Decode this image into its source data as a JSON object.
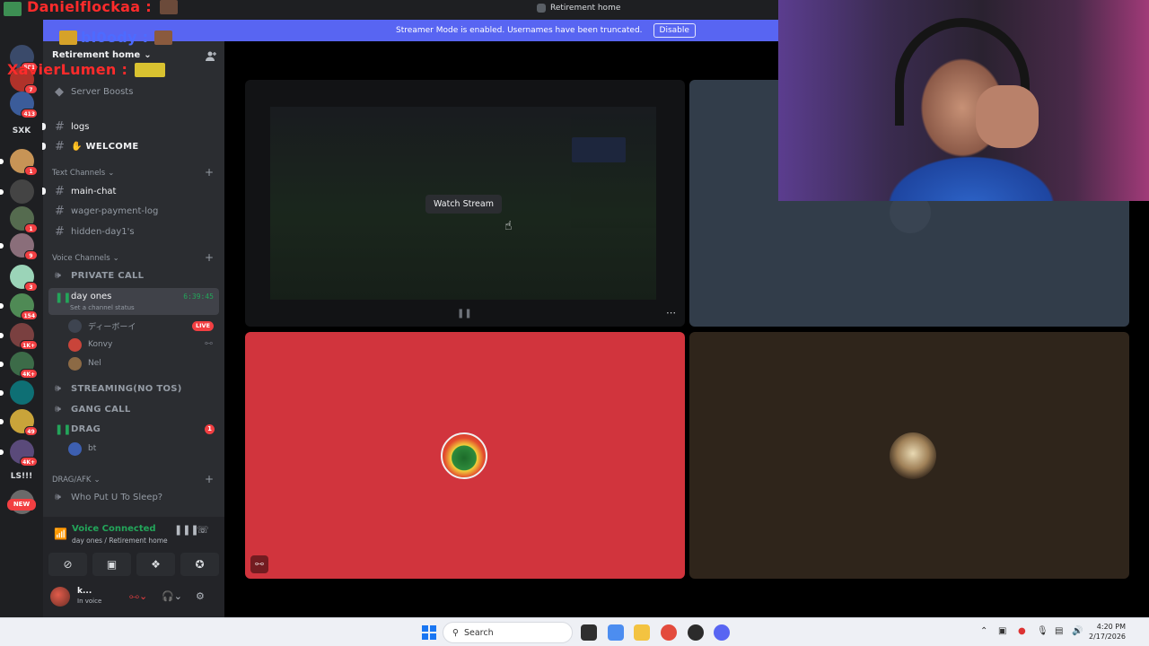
{
  "window": {
    "title": "Retirement home"
  },
  "banner": {
    "message": "Streamer Mode is enabled. Usernames have been truncated.",
    "disable_label": "Disable"
  },
  "overlay_chat": {
    "name1": "Danielflockaa :",
    "name2": "bl0ody :",
    "name3": "XavierLumen :"
  },
  "server_rail": {
    "badges": [
      "581",
      "7",
      "413",
      "1",
      "1",
      "1",
      "9",
      "3",
      "154",
      "1K+",
      "4K+",
      "49",
      "4K+"
    ],
    "text_server_1": "SXK",
    "text_server_2": "LS!!!",
    "new_label": "NEW"
  },
  "sidebar": {
    "server_name": "Retirement home",
    "server_boosts": "Server Boosts",
    "channels_top": [
      {
        "name": "logs"
      },
      {
        "name": "✋ WELCOME"
      }
    ],
    "text_category": "Text Channels",
    "text_channels": [
      {
        "name": "main-chat"
      },
      {
        "name": "wager-payment-log"
      },
      {
        "name": "hidden-day1's"
      }
    ],
    "voice_category": "Voice Channels",
    "voice_channels": {
      "private": "PRIVATE CALL",
      "day_ones": "day ones",
      "day_ones_timer": "6:39:45",
      "day_ones_status": "Set a channel status",
      "members": [
        {
          "name": "ディーボーイ",
          "live": "LIVE"
        },
        {
          "name": "Konvy"
        },
        {
          "name": "Nel"
        }
      ],
      "streaming": "STREAMING(NO TOS)",
      "gang": "GANG CALL",
      "drag": "DRAG",
      "drag_count": "1",
      "drag_member": "bt"
    },
    "afk_category": "DRAG/AFK",
    "afk_channel": "Who Put U To Sleep?"
  },
  "voice_panel": {
    "title": "Voice Connected",
    "subtitle": "day ones / Retirement home"
  },
  "user_panel": {
    "name": "k...",
    "status": "In voice"
  },
  "stage": {
    "watch_stream": "Watch Stream"
  },
  "taskbar": {
    "search_placeholder": "Search",
    "time": "4:20 PM",
    "date": "2/17/2026"
  },
  "colors": {
    "blurple": "#5865f2",
    "green": "#23a55a",
    "red": "#f23f42",
    "tile_red": "#d1343d",
    "tile_blue": "#323d4a",
    "tile_brown": "#2f251b"
  }
}
